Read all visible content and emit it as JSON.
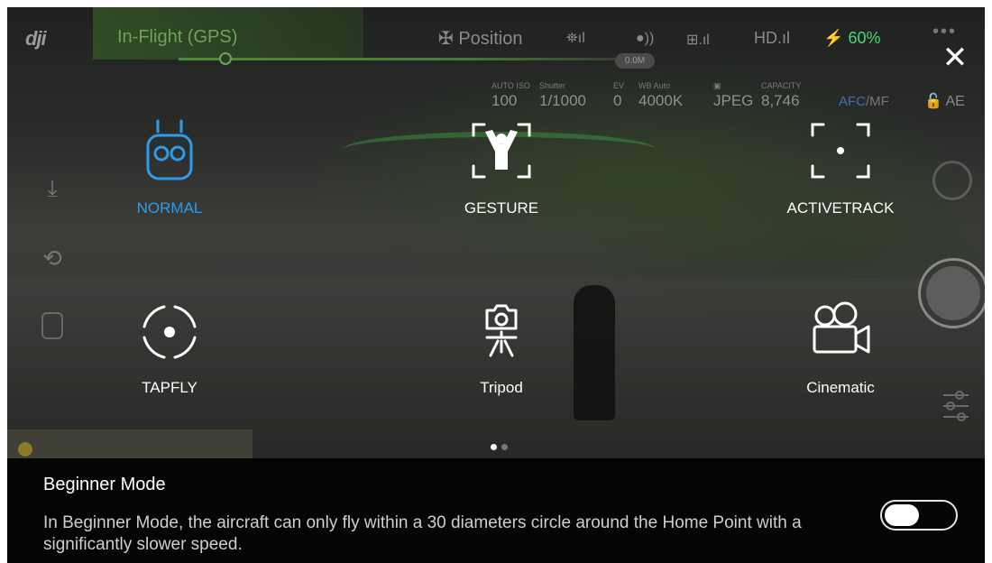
{
  "top_bar": {
    "logo": "dji",
    "flight_status": "In-Flight (GPS)",
    "mode": "Position",
    "distance_badge": "0.0M",
    "hd_label": "HD",
    "battery_percent": "60%"
  },
  "camera_info": {
    "iso_label": "AUTO ISO",
    "iso": "100",
    "shutter_label": "Shutter",
    "shutter": "1/1000",
    "ev_label": "EV",
    "ev": "0",
    "wb_label": "WB Auto",
    "wb": "4000K",
    "format": "JPEG",
    "capacity_label": "CAPACITY",
    "capacity": "8,746",
    "focus_mode": "AFC",
    "focus_alt": "/MF",
    "ae_lock": "AE"
  },
  "modes": [
    {
      "label": "NORMAL",
      "icon": "remote-controller-icon",
      "selected": true
    },
    {
      "label": "GESTURE",
      "icon": "gesture-person-icon",
      "selected": false
    },
    {
      "label": "ACTIVETRACK",
      "icon": "activetrack-frame-icon",
      "selected": false
    },
    {
      "label": "TAPFLY",
      "icon": "tapfly-target-icon",
      "selected": false
    },
    {
      "label": "Tripod",
      "icon": "camera-tripod-icon",
      "selected": false
    },
    {
      "label": "Cinematic",
      "icon": "movie-camera-icon",
      "selected": false
    }
  ],
  "pager": {
    "pages": 2,
    "current": 1
  },
  "beginner_mode": {
    "title": "Beginner Mode",
    "description": "In Beginner Mode, the aircraft can only fly within a 30 diameters circle around the Home Point with a significantly slower speed.",
    "enabled": false
  },
  "colors": {
    "selected_mode": "#2f9be8",
    "battery": "#4bd67a",
    "flight_status": "#6fa35a"
  }
}
